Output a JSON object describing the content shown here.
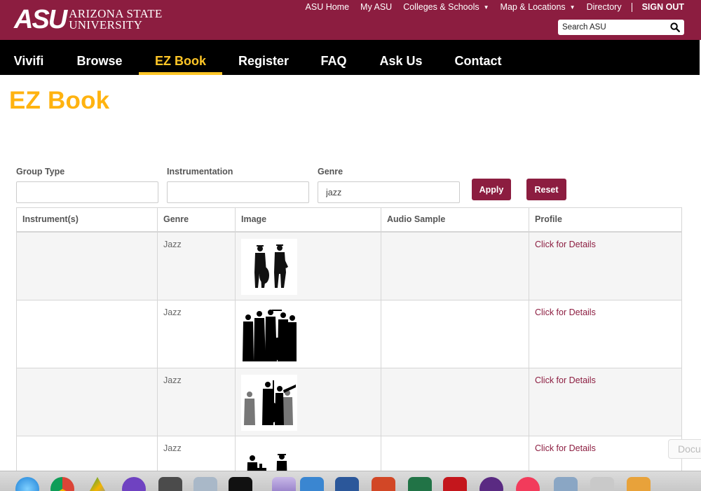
{
  "header": {
    "logo_mark": "ASU",
    "logo_line1": "ARIZONA STATE",
    "logo_line2": "UNIVERSITY",
    "links": [
      "ASU Home",
      "My ASU",
      "Colleges & Schools",
      "Map & Locations",
      "Directory"
    ],
    "signout": "SIGN OUT",
    "search_placeholder": "Search ASU",
    "brand_color": "#8c1d40",
    "accent_color": "#ffc627"
  },
  "nav": {
    "items": [
      "Vivifi",
      "Browse",
      "EZ Book",
      "Register",
      "FAQ",
      "Ask Us",
      "Contact"
    ],
    "active": "EZ Book"
  },
  "page": {
    "title": "EZ Book"
  },
  "filters": {
    "group_type_label": "Group Type",
    "group_type_value": "",
    "instrumentation_label": "Instrumentation",
    "instrumentation_value": "",
    "genre_label": "Genre",
    "genre_value": "jazz",
    "apply_label": "Apply",
    "reset_label": "Reset"
  },
  "table": {
    "headers": [
      "Instrument(s)",
      "Genre",
      "Image",
      "Audio Sample",
      "Profile"
    ],
    "rows": [
      {
        "instruments": "",
        "genre": "Jazz",
        "audio": "",
        "profile": "Click for Details"
      },
      {
        "instruments": "",
        "genre": "Jazz",
        "audio": "",
        "profile": "Click for Details"
      },
      {
        "instruments": "",
        "genre": "Jazz",
        "audio": "",
        "profile": "Click for Details"
      },
      {
        "instruments": "",
        "genre": "Jazz",
        "audio": "",
        "profile": "Click for Details"
      }
    ]
  },
  "overlay_tab": "Docu"
}
